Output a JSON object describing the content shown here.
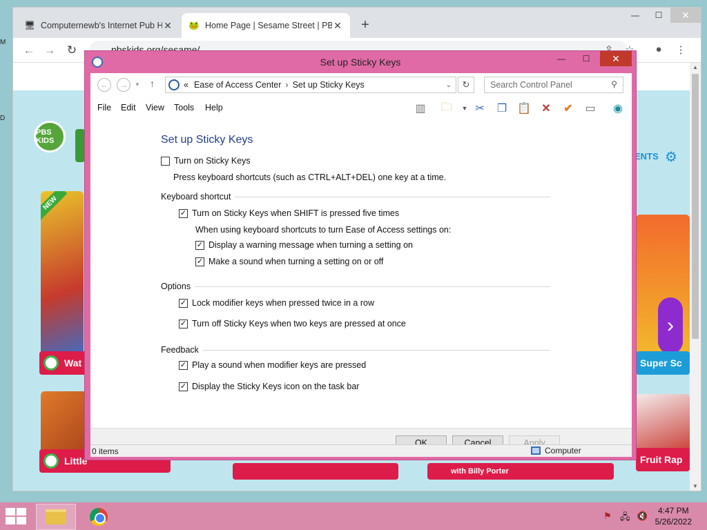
{
  "browser": {
    "tabs": [
      {
        "title": "Computernewb's Internet Pub Hub",
        "active": false
      },
      {
        "title": "Home Page | Sesame Street | PBS KIDS",
        "active": true
      }
    ],
    "url": "pbskids.org/sesame/",
    "page": {
      "logo_text": "PBS KIDS",
      "badge_new": "NEW",
      "pill_watch": "Wat",
      "pill_little": "Little",
      "pill_billy": "with Billy Porter",
      "pill_super": "Super Sc",
      "pill_fruit": "Fruit Rap",
      "nav_right": "ENTS"
    }
  },
  "window": {
    "title": "Set up Sticky Keys",
    "address": {
      "prefix": "«",
      "crumb1": "Ease of Access Center",
      "crumb2": "Set up Sticky Keys"
    },
    "search_placeholder": "Search Control Panel",
    "menu": [
      "File",
      "Edit",
      "View",
      "Tools",
      "Help"
    ],
    "heading": "Set up Sticky Keys",
    "turn_on": {
      "label": "Turn on Sticky Keys",
      "checked": false
    },
    "turn_on_desc": "Press keyboard shortcuts (such as CTRL+ALT+DEL) one key at a time.",
    "sections": {
      "keyboard_shortcut": "Keyboard shortcut",
      "options": "Options",
      "feedback": "Feedback"
    },
    "shift_five": {
      "label": "Turn on Sticky Keys when SHIFT is pressed five times",
      "checked": true
    },
    "shortcut_note": "When using keyboard shortcuts to turn Ease of Access settings on:",
    "warning_msg": {
      "label": "Display a warning message when turning a setting on",
      "checked": true
    },
    "sound_onoff": {
      "label": "Make a sound when turning a setting on or off",
      "checked": true
    },
    "lock_modifier": {
      "label": "Lock modifier keys when pressed twice in a row",
      "checked": true
    },
    "turn_off_two": {
      "label": "Turn off Sticky Keys when two keys are pressed at once",
      "checked": true
    },
    "play_sound": {
      "label": "Play a sound when modifier keys are pressed",
      "checked": true
    },
    "taskbar_icon": {
      "label": "Display the Sticky Keys icon on the task bar",
      "checked": true
    },
    "buttons": {
      "ok": "OK",
      "cancel": "Cancel",
      "apply": "Apply"
    },
    "status": {
      "items": "0 items",
      "location": "Computer"
    }
  },
  "taskbar": {
    "time": "4:47 PM",
    "date": "5/26/2022"
  },
  "colors": {
    "window_frame": "#e06aa6",
    "taskbar": "#d98aab",
    "heading_blue": "#1e3d8f"
  }
}
